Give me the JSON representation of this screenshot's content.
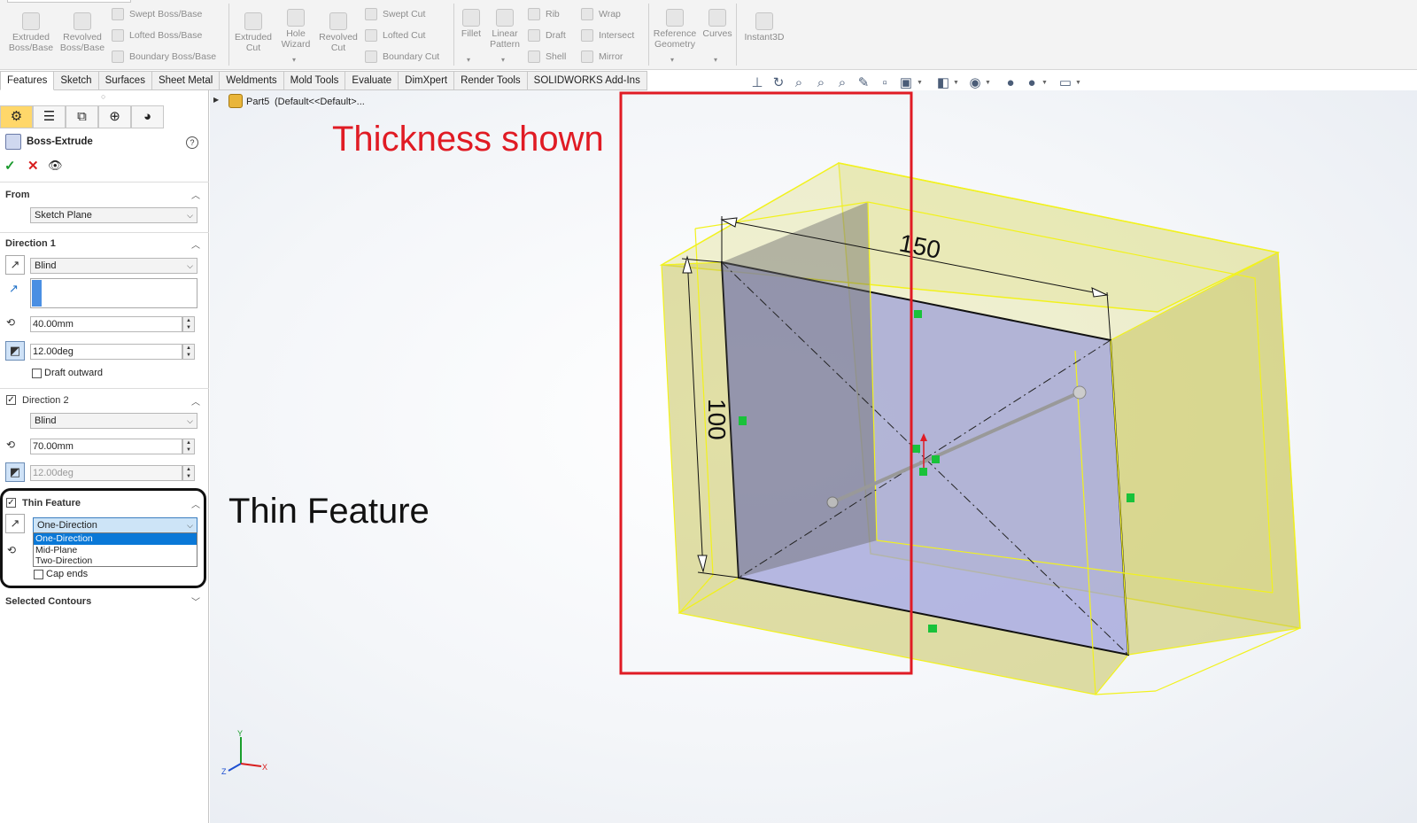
{
  "ribbon": {
    "big": [
      {
        "label": "Extruded\nBoss/Base",
        "icon": "extruded-boss-icon"
      },
      {
        "label": "Revolved\nBoss/Base",
        "icon": "revolved-boss-icon"
      },
      {
        "label": "Extruded\nCut",
        "icon": "extruded-cut-icon"
      },
      {
        "label": "Hole\nWizard",
        "icon": "hole-wizard-icon"
      },
      {
        "label": "Revolved\nCut",
        "icon": "revolved-cut-icon"
      },
      {
        "label": "Fillet",
        "icon": "fillet-icon"
      },
      {
        "label": "Linear\nPattern",
        "icon": "linear-pattern-icon"
      },
      {
        "label": "Reference\nGeometry",
        "icon": "reference-geometry-icon"
      },
      {
        "label": "Curves",
        "icon": "curves-icon"
      },
      {
        "label": "Instant3D",
        "icon": "instant3d-icon"
      }
    ],
    "small": {
      "swept_boss": "Swept Boss/Base",
      "lofted_boss": "Lofted Boss/Base",
      "boundary_boss": "Boundary Boss/Base",
      "swept_cut": "Swept Cut",
      "lofted_cut": "Lofted Cut",
      "boundary_cut": "Boundary Cut",
      "rib": "Rib",
      "draft": "Draft",
      "shell": "Shell",
      "wrap": "Wrap",
      "intersect": "Intersect",
      "mirror": "Mirror"
    }
  },
  "tabs": [
    "Features",
    "Sketch",
    "Surfaces",
    "Sheet Metal",
    "Weldments",
    "Mold Tools",
    "Evaluate",
    "DimXpert",
    "Render Tools",
    "SOLIDWORKS Add-Ins"
  ],
  "pm": {
    "title": "Boss-Extrude",
    "from_label": "From",
    "from_value": "Sketch Plane",
    "dir1_label": "Direction 1",
    "dir1_type": "Blind",
    "dir1_depth": "40.00mm",
    "dir1_draft": "12.00deg",
    "draft_outward": "Draft outward",
    "dir2_label": "Direction 2",
    "dir2_type": "Blind",
    "dir2_depth": "70.00mm",
    "dir2_draft": "12.00deg",
    "thin_label": "Thin Feature",
    "thin_type": "One-Direction",
    "thin_options": [
      "One-Direction",
      "Mid-Plane",
      "Two-Direction"
    ],
    "cap_ends": "Cap ends",
    "selected_contours": "Selected Contours"
  },
  "tree": {
    "part": "Part5",
    "config": "(Default<<Default>..."
  },
  "annotations": {
    "thickness": "Thickness shown",
    "thin": "Thin Feature"
  },
  "model": {
    "dim_width": "150",
    "dim_height": "100"
  },
  "triad": {
    "y": "Y",
    "z": "Z",
    "x": "X"
  },
  "colors": {
    "annotation_red": "#e01b24",
    "preview_yellow": "#f2f21c",
    "sketch_face": "#9da0d8",
    "selection_blue": "#0a78d7",
    "active_tab": "#ffd76a"
  }
}
